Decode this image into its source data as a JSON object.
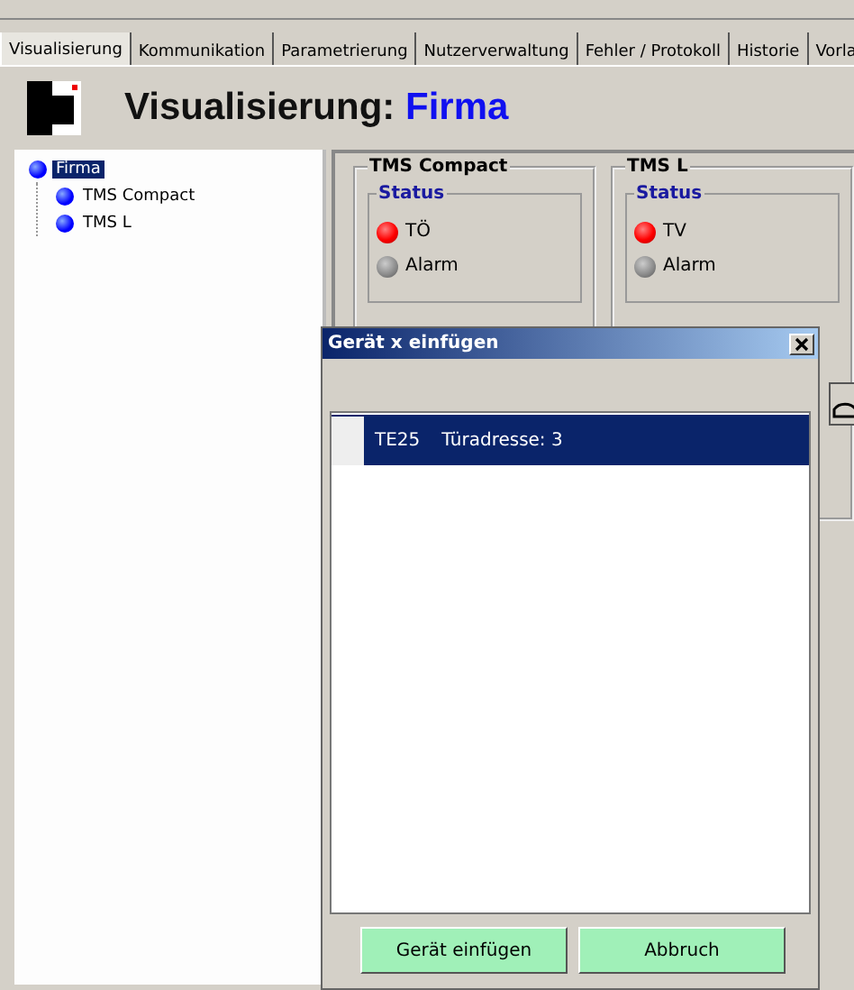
{
  "tabs": [
    {
      "label": "Visualisierung",
      "selected": true
    },
    {
      "label": "Kommunikation",
      "selected": false
    },
    {
      "label": "Parametrierung",
      "selected": false
    },
    {
      "label": "Nutzerverwaltung",
      "selected": false
    },
    {
      "label": "Fehler / Protokoll",
      "selected": false
    },
    {
      "label": "Historie",
      "selected": false
    },
    {
      "label": "Vorla",
      "selected": false
    }
  ],
  "header": {
    "title": "Visualisierung:",
    "name": "Firma"
  },
  "tree": [
    {
      "label": "Firma",
      "selected": true,
      "children": [
        {
          "label": "TMS Compact",
          "selected": false
        },
        {
          "label": "TMS L",
          "selected": false
        }
      ]
    }
  ],
  "devices": [
    {
      "title": "TMS Compact",
      "status_title": "Status",
      "leds": [
        {
          "label": "TÖ",
          "lit": true
        },
        {
          "label": "Alarm",
          "lit": false
        }
      ]
    },
    {
      "title": "TMS L",
      "status_title": "Status",
      "leds": [
        {
          "label": "TV",
          "lit": true
        },
        {
          "label": "Alarm",
          "lit": false
        }
      ]
    }
  ],
  "dialog": {
    "title": "Gerät x einfügen",
    "items": [
      {
        "name": "TE25",
        "address": "Türadresse: 3",
        "selected": true
      }
    ],
    "buttons": [
      "Gerät einfügen",
      "Abbruch"
    ]
  }
}
